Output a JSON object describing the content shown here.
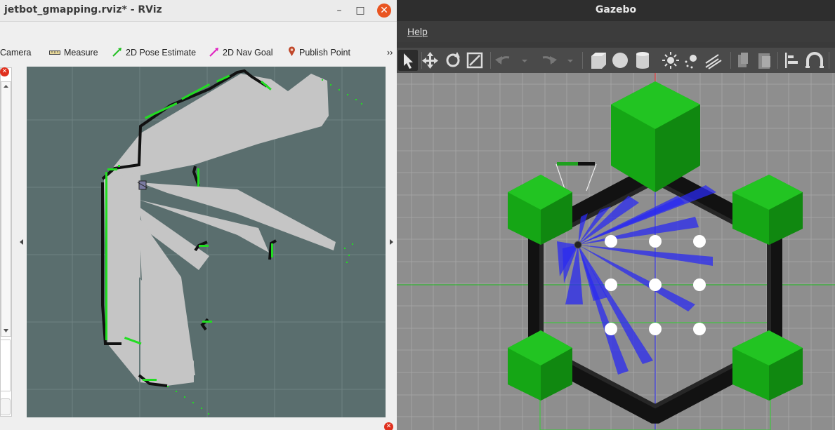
{
  "rviz": {
    "title": "jetbot_gmapping.rviz* - RViz",
    "window_buttons": {
      "minimize": "–",
      "maximize": "□",
      "close": "✕"
    },
    "toolbar": {
      "camera_label": "Camera",
      "measure_label": "Measure",
      "pose_estimate_label": "2D Pose Estimate",
      "nav_goal_label": "2D Nav Goal",
      "publish_point_label": "Publish Point",
      "overflow_label": "››"
    },
    "colors": {
      "map_background": "#5a6e6e",
      "free_space": "#c5c5c5",
      "obstacle": "#111111",
      "laser": "#22dd22"
    }
  },
  "gazebo": {
    "title": "Gazebo",
    "menu": {
      "help_label": "Help"
    },
    "toolbar_icons": [
      "select-arrow-icon",
      "translate-icon",
      "rotate-icon",
      "scale-icon",
      "undo-icon",
      "redo-icon",
      "box-icon",
      "sphere-icon",
      "cylinder-icon",
      "point-light-icon",
      "spot-light-icon",
      "directional-light-icon",
      "copy-icon",
      "paste-icon",
      "align-icon",
      "snap-icon"
    ],
    "colors": {
      "ground": "#8e8e8e",
      "wall": "#121212",
      "pillar": "#1fa01f",
      "laser": "#2222ee"
    }
  }
}
